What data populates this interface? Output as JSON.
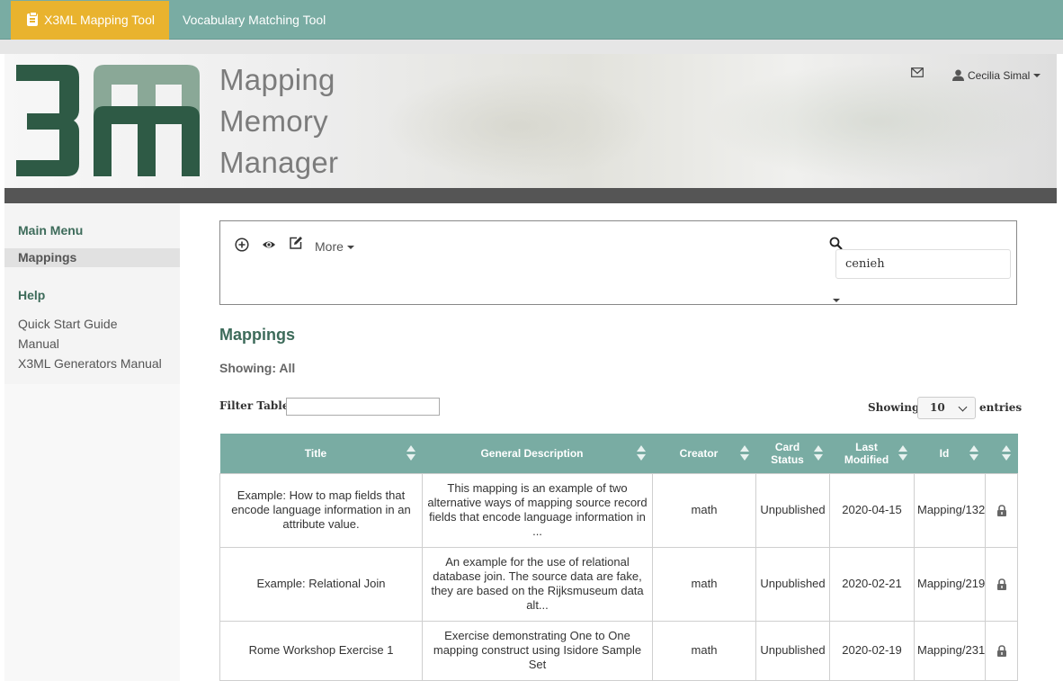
{
  "topnav": {
    "active_tab": "X3ML Mapping Tool",
    "second_tab": "Vocabulary Matching Tool"
  },
  "banner": {
    "logo_mark": "3m",
    "title_lines": [
      "Mapping",
      "Memory",
      "Manager"
    ],
    "user_name": "Cecilia Simal"
  },
  "sidebar": {
    "main_menu": "Main Menu",
    "mappings": "Mappings",
    "help": "Help",
    "links": [
      "Quick Start Guide",
      "Manual",
      "X3ML Generators Manual"
    ]
  },
  "toolbar": {
    "icons": [
      "add-icon",
      "view-icon",
      "edit-icon"
    ],
    "more_label": "More",
    "search_value": "cenieh"
  },
  "content": {
    "heading": "Mappings",
    "showing": "Showing: All",
    "filter_label": "Filter Table",
    "show_label": "Showing",
    "entries_value": "10",
    "entries_label": "entries"
  },
  "table": {
    "headers": [
      "Title",
      "General Description",
      "Creator",
      "Card Status",
      "Last Modified",
      "Id",
      ""
    ],
    "rows": [
      {
        "title": "Example: How to map fields that encode language information in an attribute value.",
        "description": "This mapping is an example of two alternative ways of mapping source record fields that encode language information in ...",
        "creator": "math",
        "status": "Unpublished",
        "modified": "2020-04-15",
        "id": "Mapping/132"
      },
      {
        "title": "Example: Relational Join",
        "description": "An example for the use of relational database join. The source data are fake, they are based on the Rijksmuseum data alt...",
        "creator": "math",
        "status": "Unpublished",
        "modified": "2020-02-21",
        "id": "Mapping/219"
      },
      {
        "title": "Rome Workshop Exercise 1",
        "description": "Exercise demonstrating One to One mapping construct using Isidore Sample Set",
        "creator": "math",
        "status": "Unpublished",
        "modified": "2020-02-19",
        "id": "Mapping/231"
      }
    ]
  },
  "colors": {
    "nav": "#79aca3",
    "active_tab": "#e9b32e",
    "heading_green": "#3d6b5a",
    "logo_dark": "#2e5a45",
    "logo_light": "#8aa897"
  }
}
